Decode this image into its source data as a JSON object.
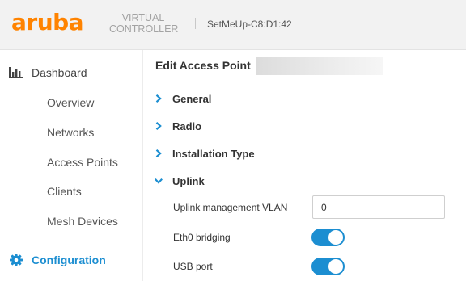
{
  "header": {
    "logo": "aruba",
    "product_line1": "VIRTUAL",
    "product_line2": "CONTROLLER",
    "device_name": "SetMeUp-C8:D1:42"
  },
  "sidebar": {
    "dashboard_label": "Dashboard",
    "items": [
      {
        "label": "Overview"
      },
      {
        "label": "Networks"
      },
      {
        "label": "Access Points"
      },
      {
        "label": "Clients"
      },
      {
        "label": "Mesh Devices"
      }
    ],
    "configuration_label": "Configuration"
  },
  "main": {
    "title": "Edit Access Point",
    "sections": [
      {
        "label": "General",
        "expanded": false
      },
      {
        "label": "Radio",
        "expanded": false
      },
      {
        "label": "Installation Type",
        "expanded": false
      },
      {
        "label": "Uplink",
        "expanded": true
      }
    ],
    "uplink": {
      "vlan_label": "Uplink management VLAN",
      "vlan_value": "0",
      "eth0_label": "Eth0 bridging",
      "eth0_on": true,
      "usb_label": "USB port",
      "usb_on": true
    }
  },
  "colors": {
    "brand_orange": "#ff8300",
    "accent_blue": "#1c8ed1"
  }
}
